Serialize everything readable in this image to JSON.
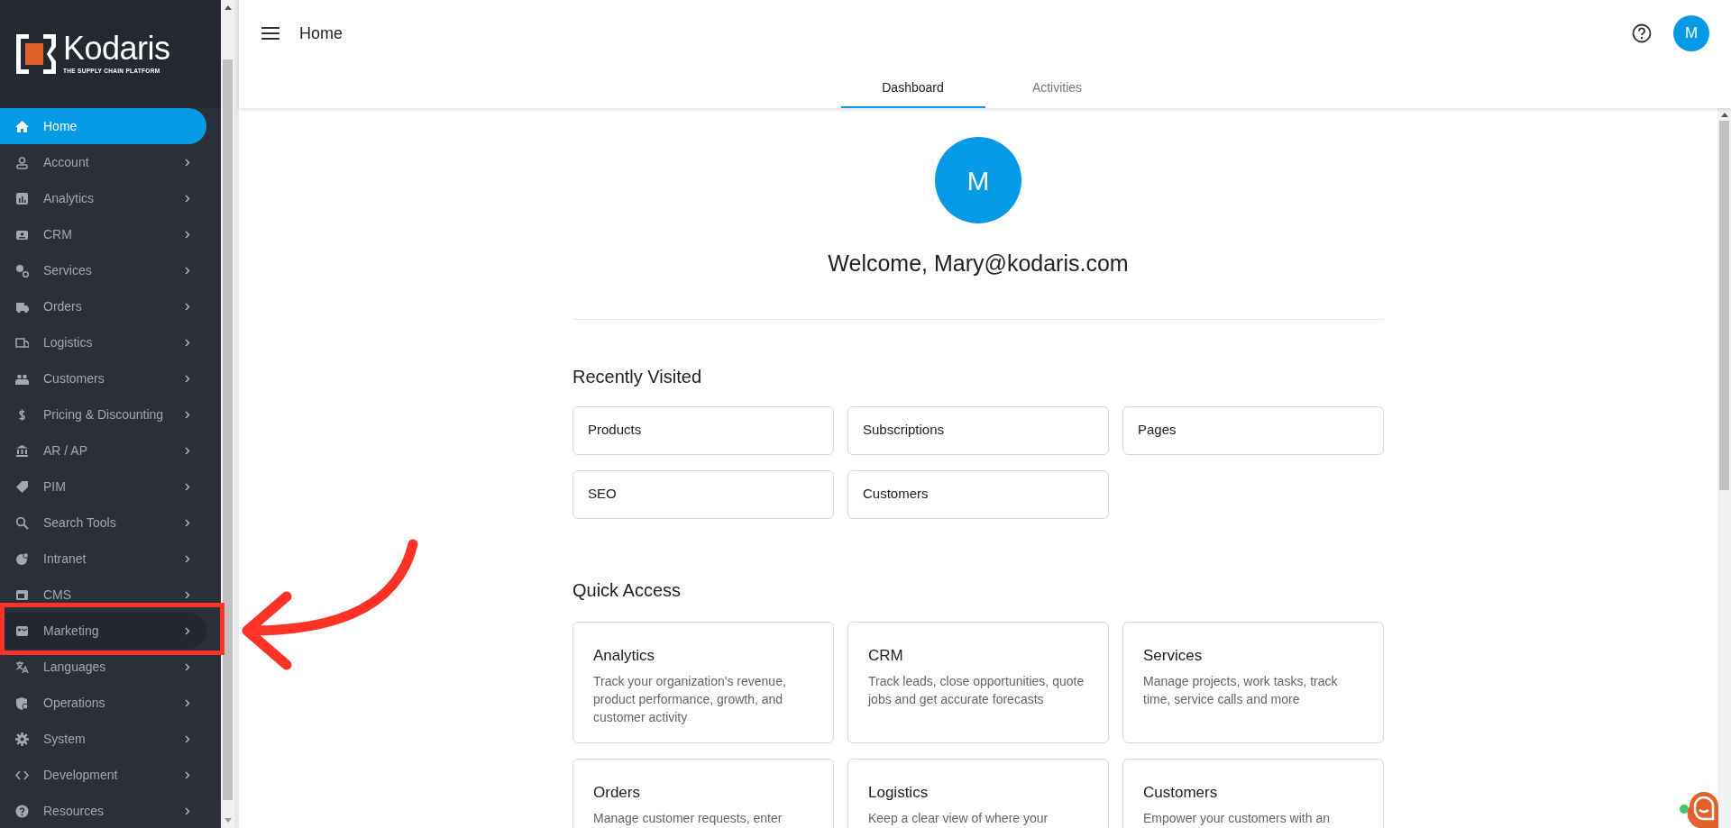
{
  "sidebar": {
    "logo": {
      "name": "Kodaris",
      "tagline": "THE SUPPLY CHAIN PLATFORM"
    },
    "items": [
      {
        "label": "Home",
        "selected": true,
        "highlighted": false,
        "expandable": false
      },
      {
        "label": "Account",
        "selected": false,
        "highlighted": false,
        "expandable": true
      },
      {
        "label": "Analytics",
        "selected": false,
        "highlighted": false,
        "expandable": true
      },
      {
        "label": "CRM",
        "selected": false,
        "highlighted": false,
        "expandable": true
      },
      {
        "label": "Services",
        "selected": false,
        "highlighted": false,
        "expandable": true
      },
      {
        "label": "Orders",
        "selected": false,
        "highlighted": false,
        "expandable": true
      },
      {
        "label": "Logistics",
        "selected": false,
        "highlighted": false,
        "expandable": true
      },
      {
        "label": "Customers",
        "selected": false,
        "highlighted": false,
        "expandable": true
      },
      {
        "label": "Pricing & Discounting",
        "selected": false,
        "highlighted": false,
        "expandable": true
      },
      {
        "label": "AR / AP",
        "selected": false,
        "highlighted": false,
        "expandable": true
      },
      {
        "label": "PIM",
        "selected": false,
        "highlighted": false,
        "expandable": true
      },
      {
        "label": "Search Tools",
        "selected": false,
        "highlighted": false,
        "expandable": true
      },
      {
        "label": "Intranet",
        "selected": false,
        "highlighted": false,
        "expandable": true
      },
      {
        "label": "CMS",
        "selected": false,
        "highlighted": false,
        "expandable": true
      },
      {
        "label": "Marketing",
        "selected": false,
        "highlighted": true,
        "expandable": true
      },
      {
        "label": "Languages",
        "selected": false,
        "highlighted": false,
        "expandable": true
      },
      {
        "label": "Operations",
        "selected": false,
        "highlighted": false,
        "expandable": true
      },
      {
        "label": "System",
        "selected": false,
        "highlighted": false,
        "expandable": true
      },
      {
        "label": "Development",
        "selected": false,
        "highlighted": false,
        "expandable": true
      },
      {
        "label": "Resources",
        "selected": false,
        "highlighted": false,
        "expandable": true
      }
    ]
  },
  "header": {
    "title": "Home",
    "avatar": "M"
  },
  "tabs": [
    {
      "label": "Dashboard",
      "selected": true
    },
    {
      "label": "Activities",
      "selected": false
    }
  ],
  "welcome": {
    "avatar": "M",
    "text": "Welcome, Mary@kodaris.com"
  },
  "recently_visited": {
    "title": "Recently Visited",
    "items": [
      "Products",
      "Subscriptions",
      "Pages",
      "SEO",
      "Customers"
    ]
  },
  "quick_access": {
    "title": "Quick Access",
    "items": [
      {
        "title": "Analytics",
        "description": "Track your organization's revenue, product performance, growth, and customer activity"
      },
      {
        "title": "CRM",
        "description": "Track leads, close opportunities, quote jobs and get accurate forecasts"
      },
      {
        "title": "Services",
        "description": "Manage projects, work tasks, track time, service calls and more"
      },
      {
        "title": "Orders",
        "description": "Manage customer requests, enter"
      },
      {
        "title": "Logistics",
        "description": "Keep a clear view of where your"
      },
      {
        "title": "Customers",
        "description": "Empower your customers with an"
      }
    ]
  }
}
